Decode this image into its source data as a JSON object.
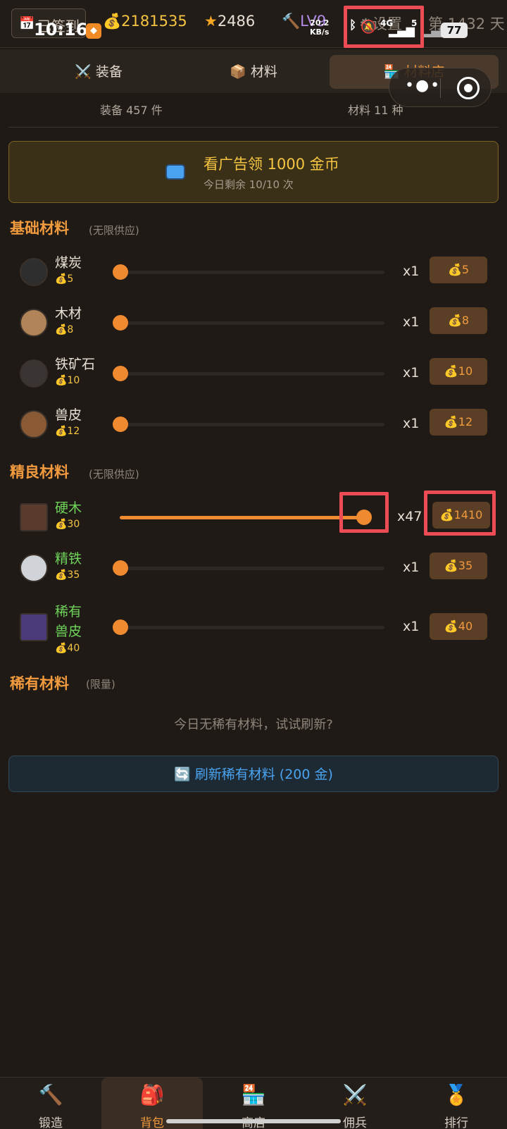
{
  "status_bar": {
    "time": "10:16",
    "net_speed_value": "20.2",
    "net_speed_unit": "KB/s",
    "network": "4G",
    "signal": "5",
    "battery": "77"
  },
  "header": {
    "checkin_label": "已签到",
    "checkin_icon": "📅",
    "gold_icon": "💰",
    "gold": "2181535",
    "star_icon": "★",
    "stars": "2486",
    "level_icon": "🔨",
    "level": "LV9",
    "settings_label": "设置",
    "days_label": "第 1432 天"
  },
  "tabs": [
    {
      "icon": "⚔️",
      "label": "装备"
    },
    {
      "icon": "📦",
      "label": "材料"
    },
    {
      "icon": "🏪",
      "label": "材料店"
    }
  ],
  "counts": {
    "equipment": "装备 457 件",
    "materials": "材料 11 种"
  },
  "ad": {
    "title": "看广告领 1000 金币",
    "subtitle": "今日剩余 10/10 次"
  },
  "sections": {
    "basic": {
      "title": "基础材料",
      "note": "(无限供应)"
    },
    "fine": {
      "title": "精良材料",
      "note": "(无限供应)"
    },
    "rare": {
      "title": "稀有材料",
      "note": "(限量)"
    }
  },
  "materials_basic": [
    {
      "name": "煤炭",
      "price": "💰5",
      "qty": "x1",
      "cost": "💰5",
      "slider": 0
    },
    {
      "name": "木材",
      "price": "💰8",
      "qty": "x1",
      "cost": "💰8",
      "slider": 0
    },
    {
      "name": "铁矿石",
      "price": "💰10",
      "qty": "x1",
      "cost": "💰10",
      "slider": 0
    },
    {
      "name": "兽皮",
      "price": "💰12",
      "qty": "x1",
      "cost": "💰12",
      "slider": 0
    }
  ],
  "materials_fine": [
    {
      "name": "硬木",
      "price": "💰30",
      "qty": "x47",
      "cost": "💰1410",
      "slider": 1.0
    },
    {
      "name": "精铁",
      "price": "💰35",
      "qty": "x1",
      "cost": "💰35",
      "slider": 0
    },
    {
      "name": "稀有\n兽皮",
      "price": "💰40",
      "qty": "x1",
      "cost": "💰40",
      "slider": 0
    }
  ],
  "rare_empty": "今日无稀有材料，试试刷新?",
  "refresh_button": "🔄 刷新稀有材料 (200 金)",
  "bottom_nav": [
    {
      "icon": "🔨",
      "label": "锻造"
    },
    {
      "icon": "🎒",
      "label": "背包"
    },
    {
      "icon": "🏪",
      "label": "商店"
    },
    {
      "icon": "⚔️",
      "label": "佣兵"
    },
    {
      "icon": "🏅",
      "label": "排行"
    }
  ],
  "colors": {
    "accent": "#f19a3e",
    "gold": "#f5c542",
    "green": "#6fd45a",
    "highlight": "#ee4c55"
  }
}
